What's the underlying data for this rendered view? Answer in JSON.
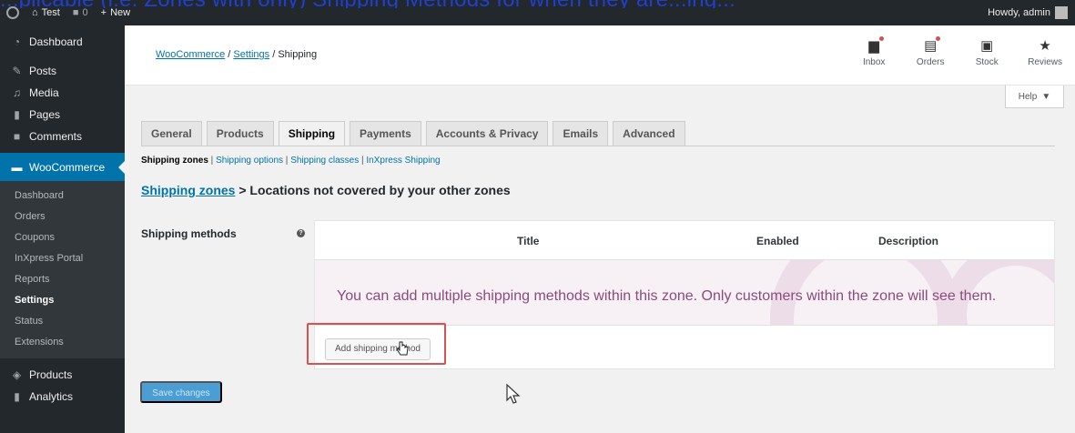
{
  "overlay": {
    "text": "...plicable (i.e. Zones with only) Shipping Methods for when they are...ing..."
  },
  "adminbar": {
    "site_name": "Test",
    "comments_count": "0",
    "new_label": "New",
    "howdy": "Howdy, admin"
  },
  "sidebar": {
    "items": [
      {
        "label": "Dashboard",
        "icon": "dashboard-icon"
      },
      {
        "label": "Posts",
        "icon": "pin-icon"
      },
      {
        "label": "Media",
        "icon": "media-icon"
      },
      {
        "label": "Pages",
        "icon": "pages-icon"
      },
      {
        "label": "Comments",
        "icon": "comment-icon"
      }
    ],
    "active": {
      "label": "WooCommerce",
      "icon": "woo-icon"
    },
    "submenu": [
      "Dashboard",
      "Orders",
      "Coupons",
      "InXpress Portal",
      "Reports",
      "Settings",
      "Status",
      "Extensions"
    ],
    "after": [
      {
        "label": "Products",
        "icon": "box-icon"
      },
      {
        "label": "Analytics",
        "icon": "bars-icon"
      }
    ]
  },
  "header": {
    "breadcrumb": {
      "woocommerce": "WooCommerce",
      "settings": "Settings",
      "current": "Shipping",
      "sep": "/"
    },
    "actions": [
      {
        "label": "Inbox",
        "icon": "inbox-icon"
      },
      {
        "label": "Orders",
        "icon": "orders-icon"
      },
      {
        "label": "Stock",
        "icon": "stock-icon"
      },
      {
        "label": "Reviews",
        "icon": "star-icon"
      }
    ]
  },
  "help": {
    "label": "Help"
  },
  "tabs": [
    "General",
    "Products",
    "Shipping",
    "Payments",
    "Accounts & Privacy",
    "Emails",
    "Advanced"
  ],
  "active_tab": "Shipping",
  "subsub": {
    "current": "Shipping zones",
    "links": [
      "Shipping options",
      "Shipping classes",
      "InXpress Shipping"
    ],
    "sep": "|"
  },
  "zone": {
    "link": "Shipping zones",
    "title": "> Locations not covered by your other zones"
  },
  "methods": {
    "label": "Shipping methods",
    "columns": {
      "title": "Title",
      "enabled": "Enabled",
      "description": "Description"
    },
    "blank_message": "You can add multiple shipping methods within this zone. Only customers within the zone will see them.",
    "add_button": "Add shipping method"
  },
  "save_button": "Save changes",
  "colors": {
    "accent": "#0073aa",
    "admin_bg": "#23282d",
    "highlight": "#d95050",
    "blank_text": "#8a4a7d"
  }
}
